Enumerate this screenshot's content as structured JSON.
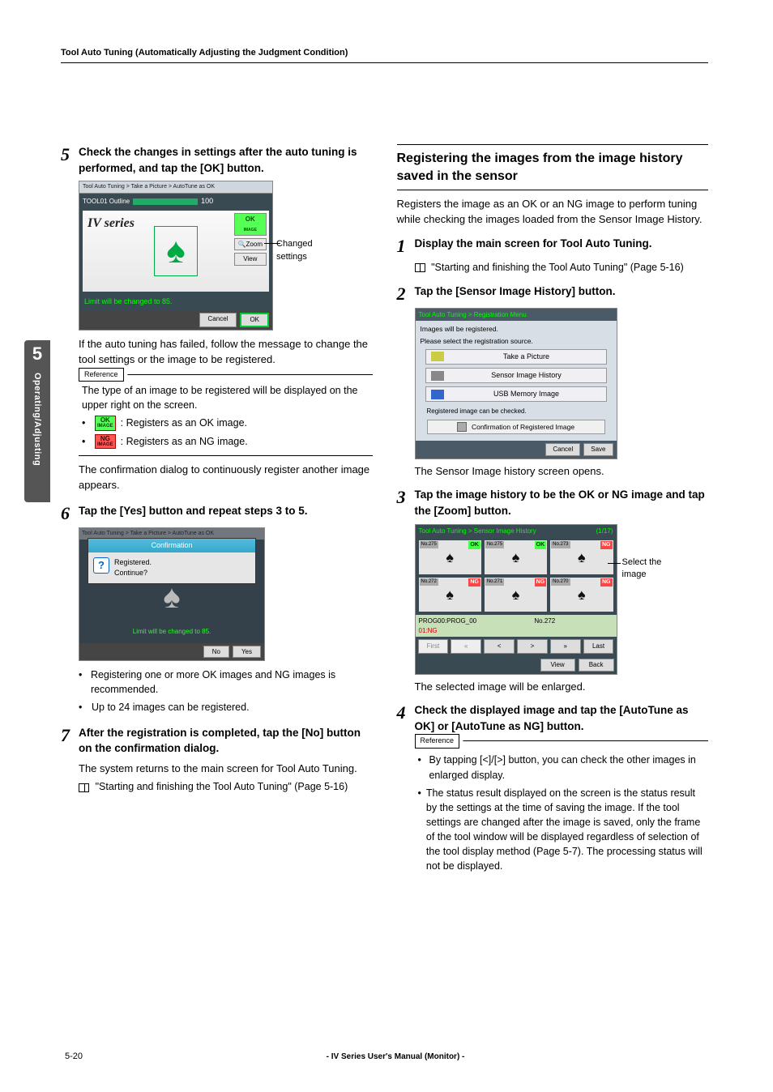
{
  "header": "Tool Auto Tuning (Automatically Adjusting the Judgment Condition)",
  "side_tab": {
    "num": "5",
    "label": "Operating/Adjusting"
  },
  "left": {
    "step5": {
      "num": "5",
      "title": "Check the changes in settings after the auto tuning is performed, and tap the [OK] button.",
      "ss": {
        "breadcrumb": "Tool Auto Tuning > Take a Picture > AutoTune as OK",
        "tool_label": "TOOL01 Outline",
        "value": "100",
        "brand": "IV series",
        "ok_btn": "OK",
        "ok_sub": "IMAGE",
        "zoom": "Zoom",
        "view": "View",
        "msg": "Limit will be changed to 85.",
        "cancel": "Cancel",
        "ok": "OK"
      },
      "callout": "Changed settings",
      "after": "If the auto tuning has failed, follow the message to change the tool settings or the image to be registered.",
      "ref": {
        "label": "Reference",
        "text": "The type of an image to be registered will be displayed on the upper right on the screen.",
        "ok": {
          "label": "OK",
          "sub": "IMAGE",
          "desc": ": Registers as an OK image."
        },
        "ng": {
          "label": "NG",
          "sub": "IMAGE",
          "desc": ": Registers as an NG image."
        }
      },
      "after2": "The confirmation dialog to continuously register another image appears."
    },
    "step6": {
      "num": "6",
      "title": "Tap the [Yes] button and repeat steps 3 to 5.",
      "ss": {
        "breadcrumb": "Tool Auto Tuning > Take a Picture > AutoTune as OK",
        "confirm_title": "Confirmation",
        "confirm_text1": "Registered.",
        "confirm_text2": "Continue?",
        "no": "No",
        "yes": "Yes"
      },
      "bullets": [
        "Registering one or more OK images and NG images is recommended.",
        "Up to 24 images can be registered."
      ]
    },
    "step7": {
      "num": "7",
      "title": "After the registration is completed, tap the [No] button on the confirmation dialog.",
      "body": "The system returns to the main screen for Tool Auto Tuning.",
      "link": "\"Starting and finishing the Tool Auto Tuning\" (Page 5-16)"
    }
  },
  "right": {
    "section_title": "Registering the images from the image history saved in the sensor",
    "intro": "Registers the image as an OK or an NG image to perform tuning while checking the images loaded from the Sensor Image History.",
    "step1": {
      "num": "1",
      "title": "Display the main screen for Tool Auto Tuning.",
      "link": "\"Starting and finishing the Tool Auto Tuning\" (Page 5-16)"
    },
    "step2": {
      "num": "2",
      "title": "Tap the [Sensor Image History] button.",
      "ss": {
        "top": "Tool Auto Tuning > Registration Menu",
        "l1": "Images will be registered.",
        "l2": "Please select the registration source.",
        "b1": "Take a Picture",
        "b2": "Sensor Image History",
        "b3": "USB Memory Image",
        "sub": "Registered image can be checked.",
        "conf": "Confirmation of Registered Image",
        "cancel": "Cancel",
        "save": "Save"
      },
      "after": "The Sensor Image history screen opens."
    },
    "step3": {
      "num": "3",
      "title": "Tap the image history to be the OK or NG image and tap the [Zoom] button.",
      "ss": {
        "top": "Tool Auto Tuning > Sensor Image History",
        "page": "(1/17)",
        "cells": [
          {
            "no": "No.275",
            "res": "OK"
          },
          {
            "no": "No.275",
            "res": "OK"
          },
          {
            "no": "No.273",
            "res": "NG"
          },
          {
            "no": "No.272",
            "res": "NG"
          },
          {
            "no": "No.271",
            "res": "NG"
          },
          {
            "no": "No.270",
            "res": "NG"
          }
        ],
        "info_prog": "PROG00:PROG_00",
        "info_no": "No.272",
        "info_ng": "01:NG",
        "nav": {
          "first": "First",
          "prev": "«",
          "l": "<",
          "r": ">",
          "next": "»",
          "last": "Last"
        },
        "view": "View",
        "back": "Back"
      },
      "callout": "Select the image",
      "after": "The selected image will be enlarged."
    },
    "step4": {
      "num": "4",
      "title": "Check the displayed image and tap the [AutoTune as OK] or [AutoTune as NG] button.",
      "ref": {
        "label": "Reference",
        "bullets": [
          "By tapping [<]/[>] button, you can check the other images in enlarged display.",
          "The status result displayed on the screen is the status result by the settings at the time of saving the image. If the tool settings are changed after the image is saved, only the frame of the tool window will be displayed regardless of selection of the tool display method (Page 5-7). The processing status will not be displayed."
        ]
      }
    }
  },
  "footer": {
    "page": "5-20",
    "mid": "- IV Series User's Manual (Monitor) -"
  }
}
